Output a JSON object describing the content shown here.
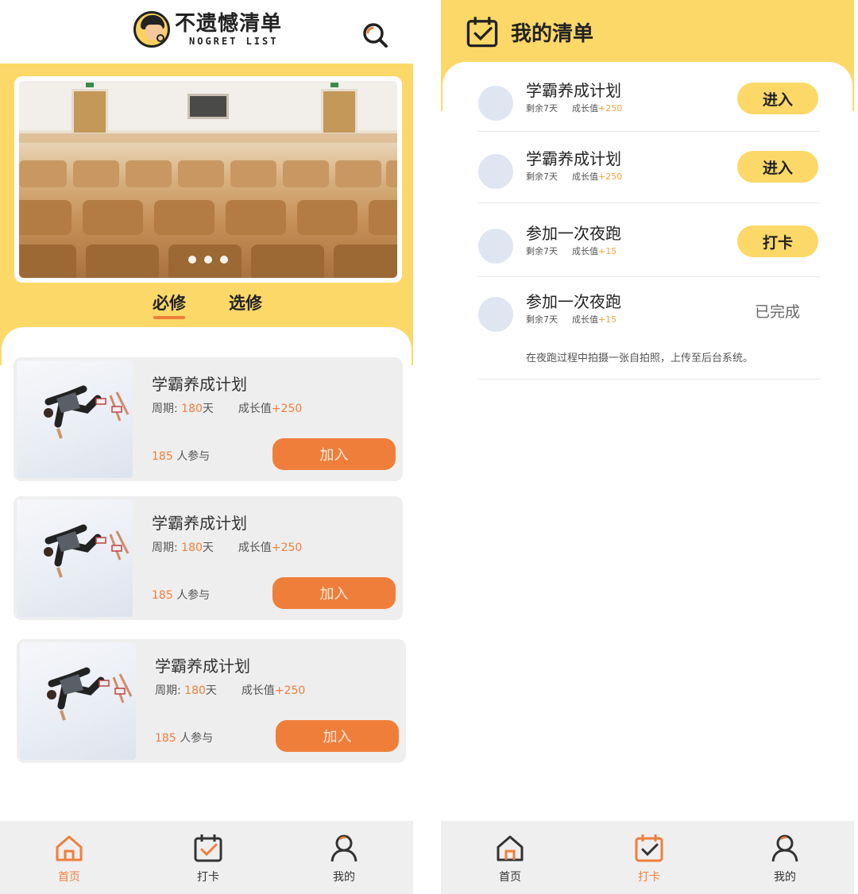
{
  "colors": {
    "accent_yellow": "#fcd868",
    "accent_orange": "#f07e3b",
    "card_bg": "#eeeeee",
    "tabbar_bg": "#efefef"
  },
  "left": {
    "logo": {
      "main": "不遗憾清单",
      "sub": "NOGRET LIST"
    },
    "search_icon": "search-icon",
    "tabs": [
      {
        "label": "必修",
        "active": true
      },
      {
        "label": "选修",
        "active": false
      }
    ],
    "cards": [
      {
        "title": "学霸养成计划",
        "period_label": "周期:",
        "period_value": "180",
        "period_unit": "天",
        "growth_label": "成长值",
        "growth_value": "+250",
        "count": "185",
        "count_label": "人参与",
        "join_label": "加入"
      },
      {
        "title": "学霸养成计划",
        "period_label": "周期:",
        "period_value": "180",
        "period_unit": "天",
        "growth_label": "成长值",
        "growth_value": "+250",
        "count": "185",
        "count_label": "人参与",
        "join_label": "加入"
      },
      {
        "title": "学霸养成计划",
        "period_label": "周期:",
        "period_value": "180",
        "period_unit": "天",
        "growth_label": "成长值",
        "growth_value": "+250",
        "count": "185",
        "count_label": "人参与",
        "join_label": "加入"
      }
    ],
    "tabbar": [
      {
        "label": "首页",
        "icon": "home-icon",
        "active": true
      },
      {
        "label": "打卡",
        "icon": "calendar-check-icon",
        "active": false
      },
      {
        "label": "我的",
        "icon": "user-icon",
        "active": false
      }
    ]
  },
  "right": {
    "title": "我的清单",
    "tasks": [
      {
        "title": "学霸养成计划",
        "remaining": "剩余7天",
        "growth_label": "成长值",
        "growth_value": "+250",
        "action": "进入"
      },
      {
        "title": "学霸养成计划",
        "remaining": "剩余7天",
        "growth_label": "成长值",
        "growth_value": "+250",
        "action": "进入"
      },
      {
        "title": "参加一次夜跑",
        "remaining": "剩余7天",
        "growth_label": "成长值",
        "growth_value": "+15",
        "action": "打卡"
      },
      {
        "title": "参加一次夜跑",
        "remaining": "剩余7天",
        "growth_label": "成长值",
        "growth_value": "+15",
        "status": "已完成",
        "note": "在夜跑过程中拍摄一张自拍照，上传至后台系统。"
      }
    ],
    "tabbar": [
      {
        "label": "首页",
        "icon": "home-icon",
        "active": false
      },
      {
        "label": "打卡",
        "icon": "calendar-check-icon",
        "active": true
      },
      {
        "label": "我的",
        "icon": "user-icon",
        "active": false
      }
    ]
  }
}
